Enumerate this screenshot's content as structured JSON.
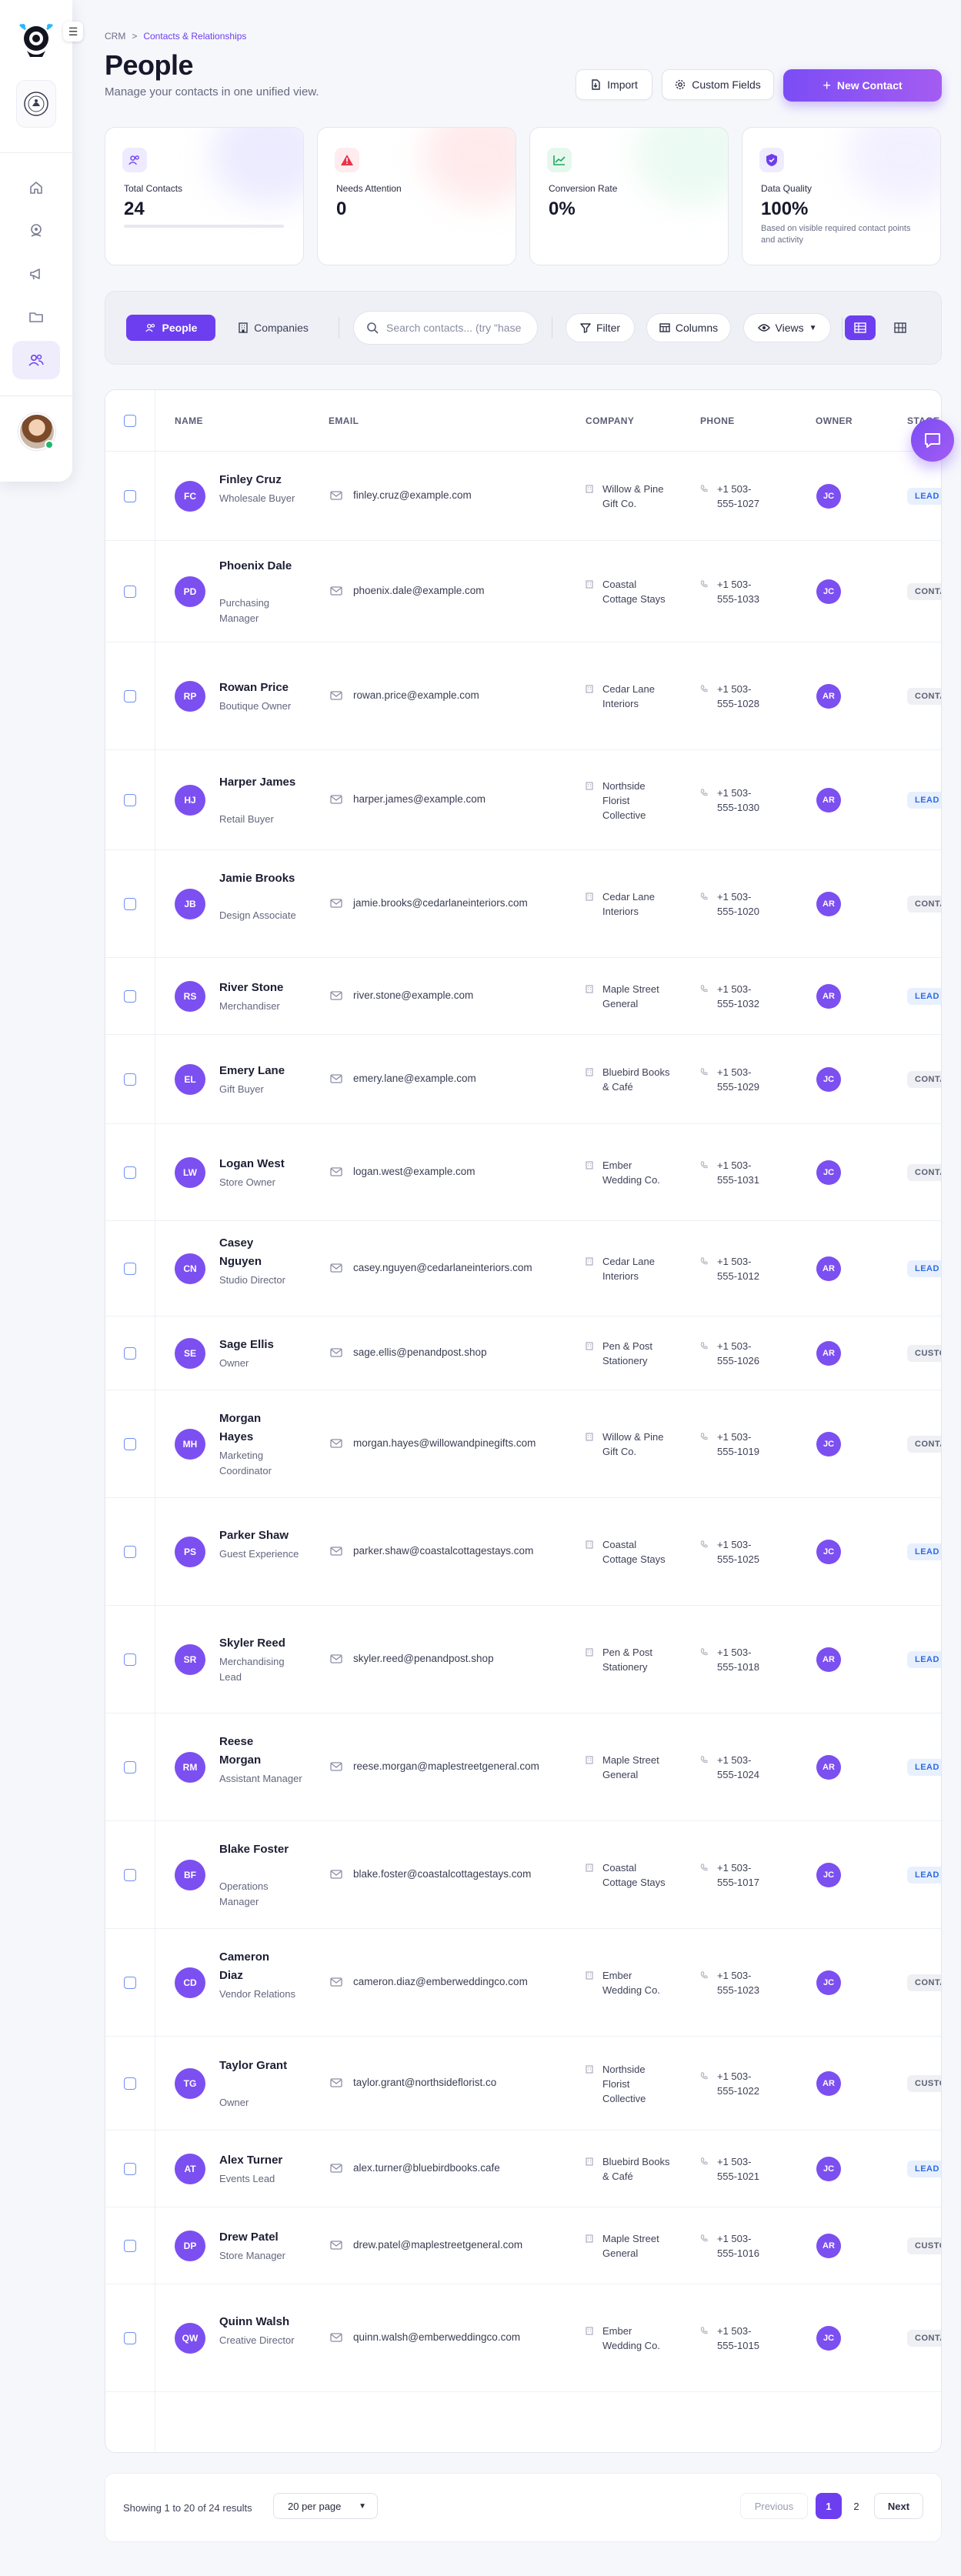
{
  "sidebar": {
    "collapse_icon": "menu-icon",
    "nav": [
      "home-icon",
      "brand-icon",
      "megaphone-icon",
      "folder-icon",
      "users-icon"
    ],
    "accent": "#6d3ef0"
  },
  "breadcrumb": {
    "root": "CRM",
    "sep": ">",
    "current": "Contacts & Relationships"
  },
  "header": {
    "title": "People",
    "subtitle": "Manage your contacts in one unified view.",
    "import_label": "Import",
    "custom_fields_label": "Custom Fields",
    "new_contact_label": "New Contact"
  },
  "stats": [
    {
      "label": "Total Contacts",
      "value": "24"
    },
    {
      "label": "Needs Attention",
      "value": "0"
    },
    {
      "label": "Conversion Rate",
      "value": "0%"
    },
    {
      "label": "Data Quality",
      "value": "100%",
      "note": "Based on visible required contact points and activity"
    }
  ],
  "toolbar": {
    "people_label": "People",
    "companies_label": "Companies",
    "search_placeholder": "Search contacts... (try \"hase",
    "filter_label": "Filter",
    "columns_label": "Columns",
    "views_label": "Views"
  },
  "table": {
    "columns": {
      "name": "NAME",
      "email": "EMAIL",
      "company": "COMPANY",
      "phone": "PHONE",
      "owner": "OWNER",
      "stage": "STAGE"
    },
    "rows": [
      {
        "initials": "FC",
        "name": "Finley Cruz",
        "role": "Wholesale Buyer",
        "email": "finley.cruz@example.com",
        "company": "Willow & Pine Gift Co.",
        "phone": "+1 503-555-1027",
        "owner": "JC",
        "stage": "LEAD"
      },
      {
        "initials": "PD",
        "name": "Phoenix Dale",
        "role": "Purchasing Manager",
        "email": "phoenix.dale@example.com",
        "company": "Coastal Cottage Stays",
        "phone": "+1 503-555-1033",
        "owner": "JC",
        "stage": "CONTACT"
      },
      {
        "initials": "RP",
        "name": "Rowan Price",
        "role": "Boutique Owner",
        "email": "rowan.price@example.com",
        "company": "Cedar Lane Interiors",
        "phone": "+1 503-555-1028",
        "owner": "AR",
        "stage": "CONTACT"
      },
      {
        "initials": "HJ",
        "name": "Harper James",
        "role": "Retail Buyer",
        "email": "harper.james@example.com",
        "company": "Northside Florist Collective",
        "phone": "+1 503-555-1030",
        "owner": "AR",
        "stage": "LEAD"
      },
      {
        "initials": "JB",
        "name": "Jamie Brooks",
        "role": "Design Associate",
        "email": "jamie.brooks@cedarlaneinteriors.com",
        "company": "Cedar Lane Interiors",
        "phone": "+1 503-555-1020",
        "owner": "AR",
        "stage": "CONTACT"
      },
      {
        "initials": "RS",
        "name": "River Stone",
        "role": "Merchandiser",
        "email": "river.stone@example.com",
        "company": "Maple Street General",
        "phone": "+1 503-555-1032",
        "owner": "AR",
        "stage": "LEAD"
      },
      {
        "initials": "EL",
        "name": "Emery Lane",
        "role": "Gift Buyer",
        "email": "emery.lane@example.com",
        "company": "Bluebird Books & Café",
        "phone": "+1 503-555-1029",
        "owner": "JC",
        "stage": "CONTACT"
      },
      {
        "initials": "LW",
        "name": "Logan West",
        "role": "Store Owner",
        "email": "logan.west@example.com",
        "company": "Ember Wedding Co.",
        "phone": "+1 503-555-1031",
        "owner": "JC",
        "stage": "CONTACT"
      },
      {
        "initials": "CN",
        "name": "Casey Nguyen",
        "role": "Studio Director",
        "email": "casey.nguyen@cedarlaneinteriors.com",
        "company": "Cedar Lane Interiors",
        "phone": "+1 503-555-1012",
        "owner": "AR",
        "stage": "LEAD"
      },
      {
        "initials": "SE",
        "name": "Sage Ellis",
        "role": "Owner",
        "email": "sage.ellis@penandpost.shop",
        "company": "Pen & Post Stationery",
        "phone": "+1 503-555-1026",
        "owner": "AR",
        "stage": "CUSTOMER"
      },
      {
        "initials": "MH",
        "name": "Morgan Hayes",
        "role": "Marketing Coordinator",
        "email": "morgan.hayes@willowandpinegifts.com",
        "company": "Willow & Pine Gift Co.",
        "phone": "+1 503-555-1019",
        "owner": "JC",
        "stage": "CONTACT"
      },
      {
        "initials": "PS",
        "name": "Parker Shaw",
        "role": "Guest Experience",
        "email": "parker.shaw@coastalcottagestays.com",
        "company": "Coastal Cottage Stays",
        "phone": "+1 503-555-1025",
        "owner": "JC",
        "stage": "LEAD"
      },
      {
        "initials": "SR",
        "name": "Skyler Reed",
        "role": "Merchandising Lead",
        "email": "skyler.reed@penandpost.shop",
        "company": "Pen & Post Stationery",
        "phone": "+1 503-555-1018",
        "owner": "AR",
        "stage": "LEAD"
      },
      {
        "initials": "RM",
        "name": "Reese Morgan",
        "role": "Assistant Manager",
        "email": "reese.morgan@maplestreetgeneral.com",
        "company": "Maple Street General",
        "phone": "+1 503-555-1024",
        "owner": "AR",
        "stage": "LEAD"
      },
      {
        "initials": "BF",
        "name": "Blake Foster",
        "role": "Operations Manager",
        "email": "blake.foster@coastalcottagestays.com",
        "company": "Coastal Cottage Stays",
        "phone": "+1 503-555-1017",
        "owner": "JC",
        "stage": "LEAD"
      },
      {
        "initials": "CD",
        "name": "Cameron Diaz",
        "role": "Vendor Relations",
        "email": "cameron.diaz@emberweddingco.com",
        "company": "Ember Wedding Co.",
        "phone": "+1 503-555-1023",
        "owner": "JC",
        "stage": "CONTACT"
      },
      {
        "initials": "TG",
        "name": "Taylor Grant",
        "role": "Owner",
        "email": "taylor.grant@northsideflorist.co",
        "company": "Northside Florist Collective",
        "phone": "+1 503-555-1022",
        "owner": "AR",
        "stage": "CUSTOMER"
      },
      {
        "initials": "AT",
        "name": "Alex Turner",
        "role": "Events Lead",
        "email": "alex.turner@bluebirdbooks.cafe",
        "company": "Bluebird Books & Café",
        "phone": "+1 503-555-1021",
        "owner": "JC",
        "stage": "LEAD"
      },
      {
        "initials": "DP",
        "name": "Drew Patel",
        "role": "Store Manager",
        "email": "drew.patel@maplestreetgeneral.com",
        "company": "Maple Street General",
        "phone": "+1 503-555-1016",
        "owner": "AR",
        "stage": "CUSTOMER"
      },
      {
        "initials": "QW",
        "name": "Quinn Walsh",
        "role": "Creative Director",
        "email": "quinn.walsh@emberweddingco.com",
        "company": "Ember Wedding Co.",
        "phone": "+1 503-555-1015",
        "owner": "JC",
        "stage": "CONTACT"
      }
    ]
  },
  "footer": {
    "showing": "Showing 1 to 20 of 24 results",
    "per_page": "20 per page",
    "previous": "Previous",
    "page1": "1",
    "page2": "2",
    "next": "Next"
  }
}
